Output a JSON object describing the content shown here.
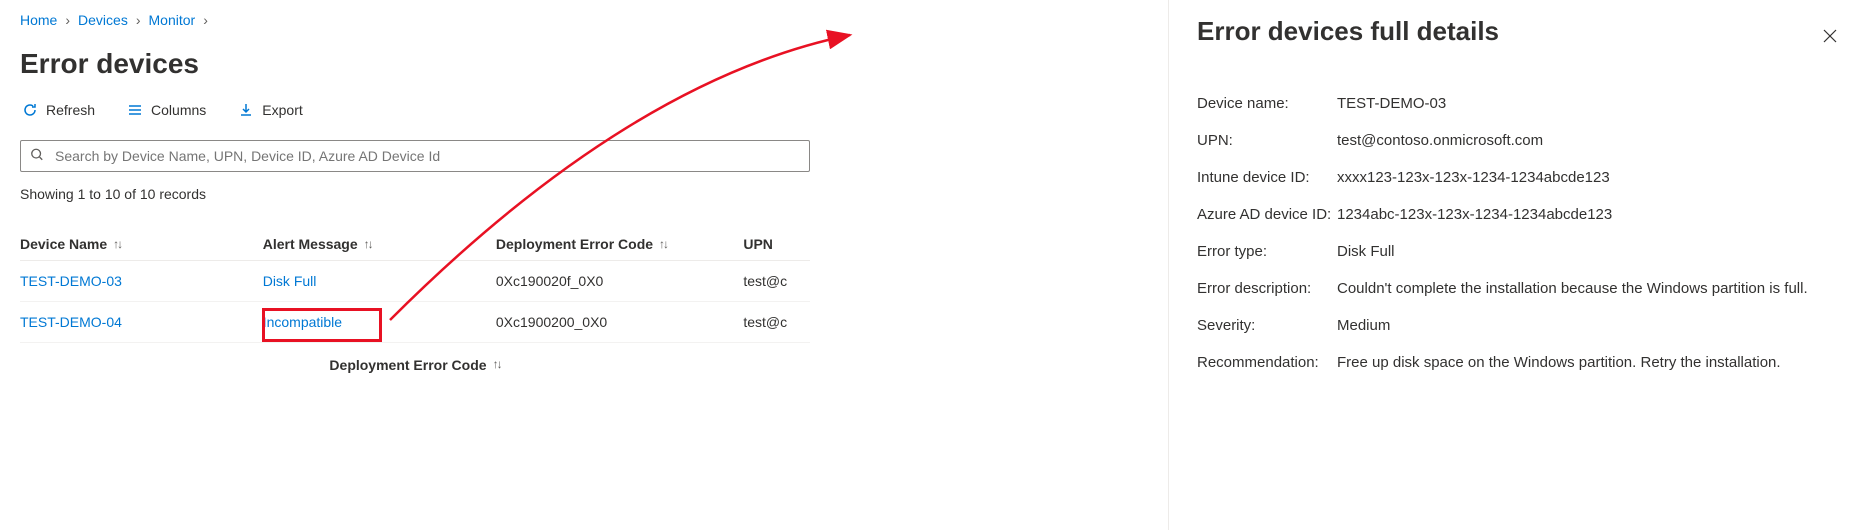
{
  "breadcrumb": {
    "home": "Home",
    "devices": "Devices",
    "monitor": "Monitor"
  },
  "page_title": "Error devices",
  "toolbar": {
    "refresh": "Refresh",
    "columns": "Columns",
    "export": "Export"
  },
  "search": {
    "placeholder": "Search by Device Name, UPN, Device ID, Azure AD Device Id"
  },
  "records_label": "Showing 1 to 10 of 10 records",
  "columns": {
    "device_name": "Device Name",
    "alert_message": "Alert Message",
    "deployment_error_code": "Deployment Error Code",
    "upn": "UPN"
  },
  "rows": [
    {
      "device": "TEST-DEMO-03",
      "alert": "Disk Full",
      "error": "0Xc190020f_0X0",
      "upn": "test@c"
    },
    {
      "device": "TEST-DEMO-04",
      "alert": "Incompatible",
      "error": "0Xc1900200_0X0",
      "upn": "test@c"
    }
  ],
  "footer_sort": "Deployment Error Code",
  "panel": {
    "title": "Error devices full details",
    "device_name_label": "Device name:",
    "device_name": "TEST-DEMO-03",
    "upn_label": "UPN:",
    "upn": "test@contoso.onmicrosoft.com",
    "intune_id_label": "Intune device ID:",
    "intune_id": "xxxx123-123x-123x-1234-1234abcde123",
    "azure_id_label": "Azure AD device ID:",
    "azure_id": "1234abc-123x-123x-1234-1234abcde123",
    "error_type_label": "Error type:",
    "error_type": "Disk Full",
    "error_desc_label": "Error description:",
    "error_desc": "Couldn't complete the installation because the Windows partition is full.",
    "severity_label": "Severity:",
    "severity": "Medium",
    "recommendation_label": "Recommendation:",
    "recommendation": "Free up disk space on the Windows partition. Retry the installation."
  }
}
